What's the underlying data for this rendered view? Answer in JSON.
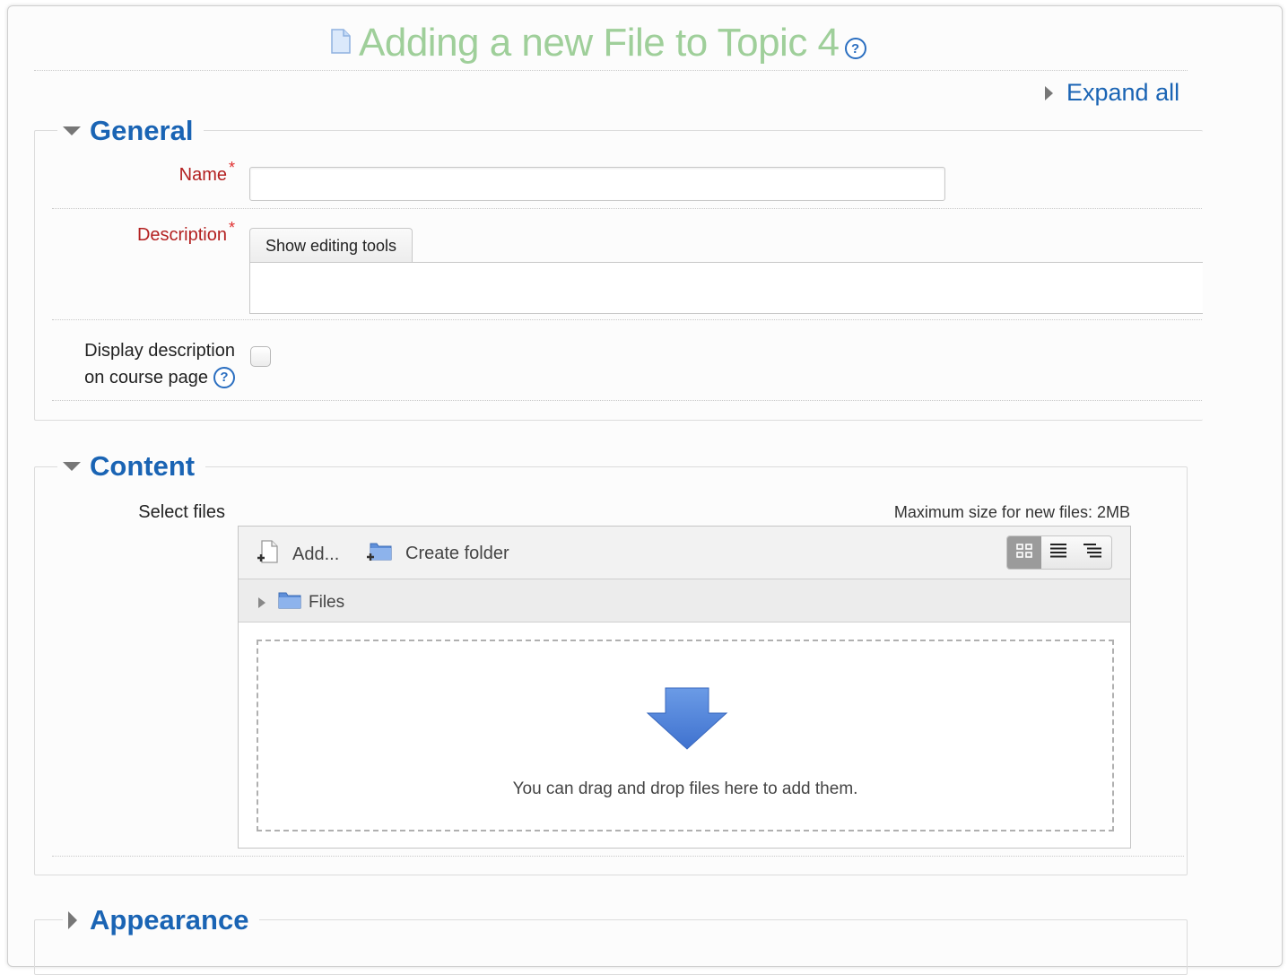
{
  "page": {
    "title": "Adding a new File to Topic 4",
    "expand_all": "Expand all"
  },
  "general": {
    "legend": "General",
    "name_label": "Name",
    "name_value": "",
    "required_mark": "*",
    "description_label": "Description",
    "show_editing_tools": "Show editing tools",
    "description_value": "",
    "display_desc_line1": "Display description",
    "display_desc_line2": "on course page",
    "display_desc_checked": false
  },
  "content": {
    "legend": "Content",
    "select_files_label": "Select files",
    "max_size": "Maximum size for new files: 2MB",
    "add_label": "Add...",
    "create_folder_label": "Create folder",
    "path_folder": "Files",
    "drop_text": "You can drag and drop files here to add them.",
    "active_view": "icons"
  },
  "appearance": {
    "legend": "Appearance"
  },
  "icons": {
    "title_icon": "file-icon",
    "help": "help-icon",
    "add": "add-file-icon",
    "create_folder": "create-folder-icon",
    "folder": "folder-icon",
    "drop": "down-arrow-icon",
    "views": [
      "icon-view-icon",
      "list-view-icon",
      "tree-view-icon"
    ]
  },
  "colors": {
    "title": "#9fcf9a",
    "link": "#1a64b4",
    "required": "#b32020",
    "drop_arrow": "#4a7fd6"
  }
}
